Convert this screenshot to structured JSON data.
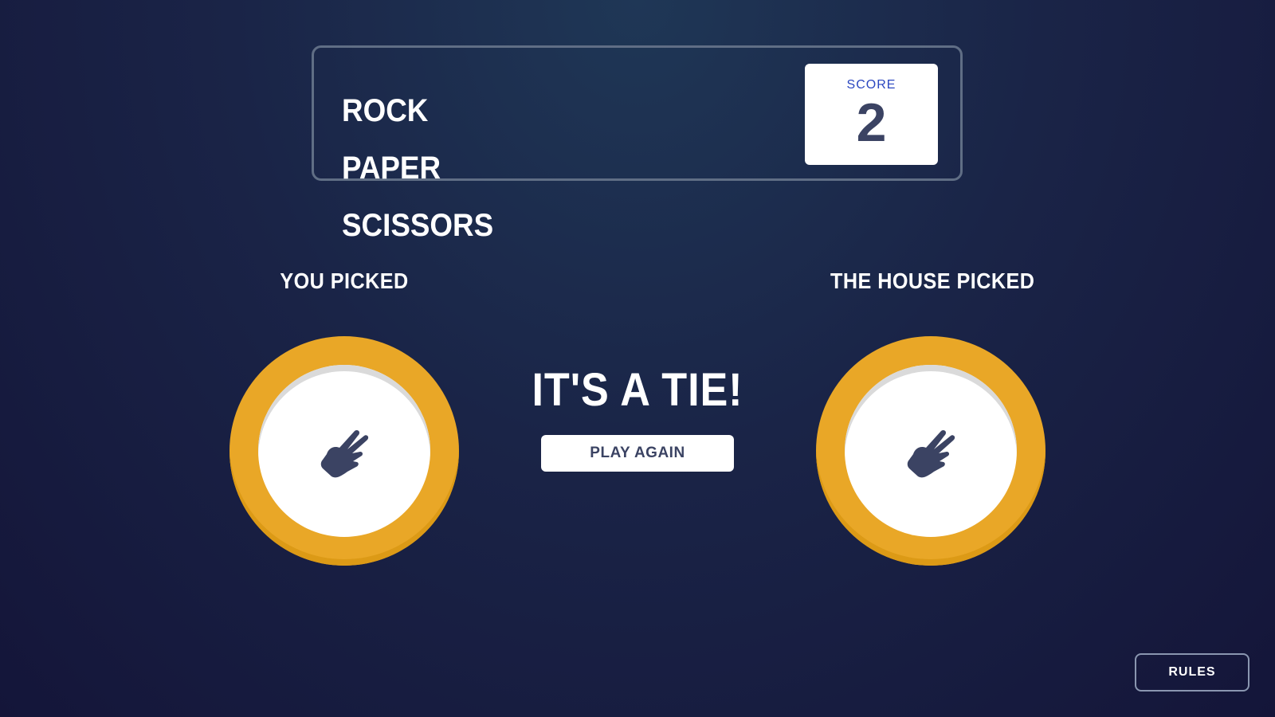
{
  "header": {
    "title_lines": [
      "ROCK",
      "PAPER",
      "SCISSORS"
    ],
    "score_label": "SCORE",
    "score_value": "2"
  },
  "player": {
    "label": "YOU PICKED",
    "choice": "scissors",
    "icon": "scissors-hand-icon"
  },
  "house": {
    "label": "THE HOUSE PICKED",
    "choice": "scissors",
    "icon": "scissors-hand-icon"
  },
  "result": {
    "text": "IT'S A TIE!",
    "play_again_label": "PLAY AGAIN"
  },
  "footer": {
    "rules_label": "RULES"
  },
  "colors": {
    "scissors_ring": "#e9a727",
    "score_label": "#2a46c0",
    "dark_text": "#3b4363",
    "header_border": "#606e85"
  }
}
